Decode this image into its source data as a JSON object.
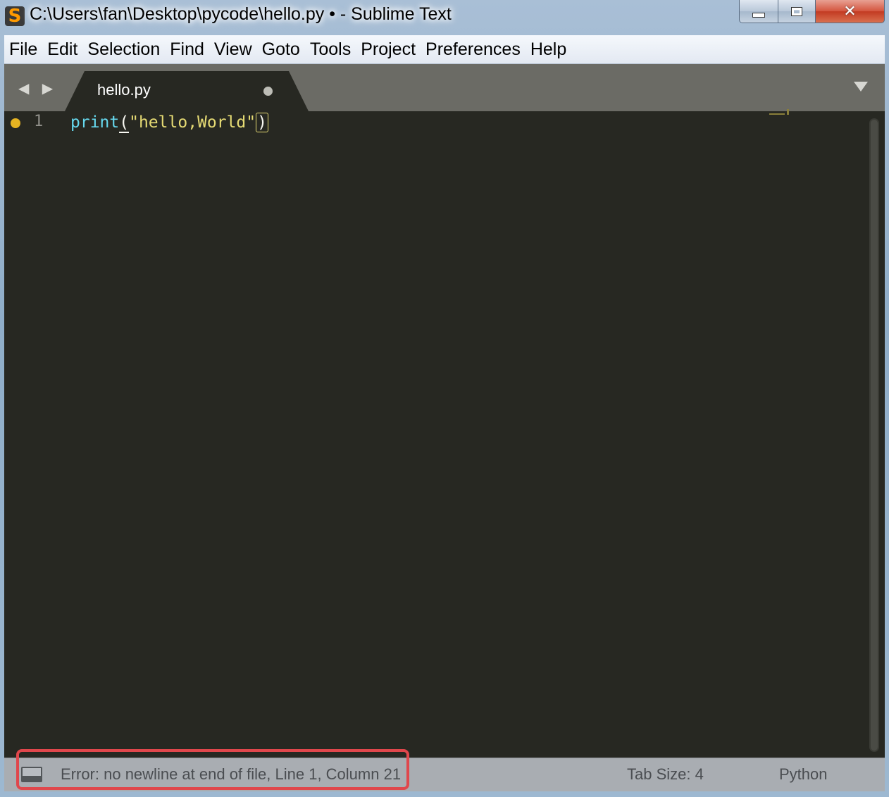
{
  "window": {
    "title": "C:\\Users\\fan\\Desktop\\pycode\\hello.py • - Sublime Text",
    "app_icon": "sublime-text-icon",
    "controls": {
      "minimize": "minimize-icon",
      "maximize": "maximize-icon",
      "close": "✕"
    }
  },
  "menubar": {
    "items": [
      "File",
      "Edit",
      "Selection",
      "Find",
      "View",
      "Goto",
      "Tools",
      "Project",
      "Preferences",
      "Help"
    ]
  },
  "tabbar": {
    "nav_arrows": "◀ ▶",
    "tabs": [
      {
        "label": "hello.py",
        "modified": true,
        "active": true
      }
    ],
    "dropdown_icon": "chevron-down-icon"
  },
  "editor": {
    "lines": [
      {
        "number": "1",
        "modified_marker": true,
        "tokens": {
          "func": "print",
          "open_paren": "(",
          "string": "\"hello,World\"",
          "close_paren": ")"
        }
      }
    ],
    "colors": {
      "background": "#272822",
      "function": "#66d9ef",
      "string": "#e6db74",
      "gutter_marker": "#e6b422"
    }
  },
  "statusbar": {
    "message": "Error: no newline at end of file, Line 1, Column 21",
    "tab_size": "Tab Size: 4",
    "syntax": "Python",
    "highlight_color": "#e0474c"
  }
}
